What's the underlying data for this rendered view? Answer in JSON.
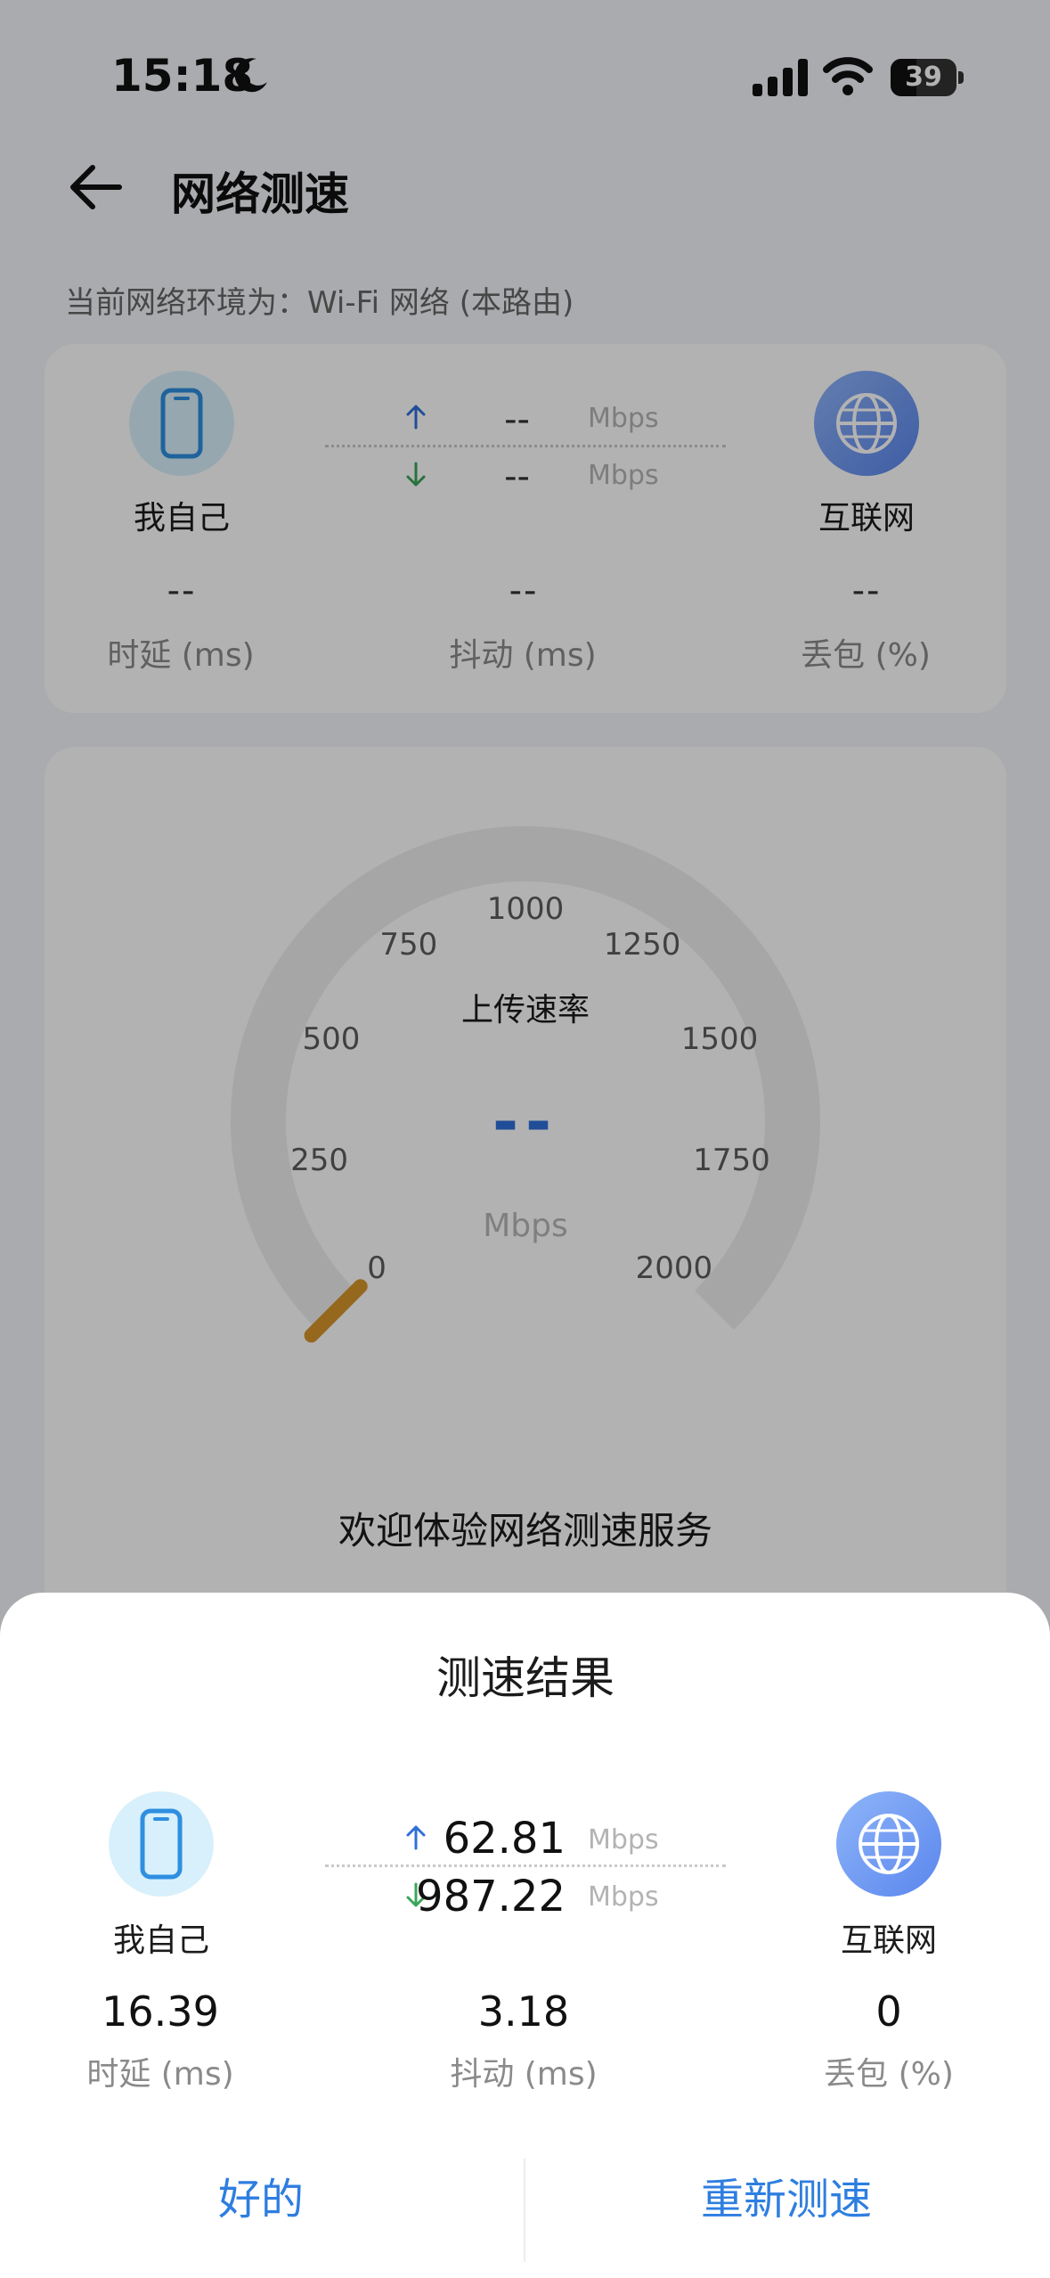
{
  "status_bar": {
    "time": "15:18",
    "battery": "39",
    "battery_level_percent": 39
  },
  "header": {
    "title": "网络测速"
  },
  "network_env": "当前网络环境为：Wi-Fi 网络 (本路由)",
  "summary_card": {
    "left_node": "我自己",
    "right_node": "互联网",
    "upload_value": "--",
    "download_value": "--",
    "upload_unit": "Mbps",
    "download_unit": "Mbps",
    "latency_value": "--",
    "latency_label": "时延 (ms)",
    "jitter_value": "--",
    "jitter_label": "抖动 (ms)",
    "loss_value": "--",
    "loss_label": "丢包 (%)"
  },
  "gauge": {
    "ticks": [
      "0",
      "250",
      "500",
      "750",
      "1000",
      "1250",
      "1500",
      "1750",
      "2000"
    ],
    "mode_label": "上传速率",
    "speed_value": "--",
    "unit": "Mbps",
    "needle_value": 0,
    "max_value": 2000
  },
  "welcome_text": "欢迎体验网络测速服务",
  "result_sheet": {
    "title": "测速结果",
    "left_node": "我自己",
    "right_node": "互联网",
    "upload_value": "62.81",
    "download_value": "987.22",
    "upload_unit": "Mbps",
    "download_unit": "Mbps",
    "latency_value": "16.39",
    "latency_label": "时延 (ms)",
    "jitter_value": "3.18",
    "jitter_label": "抖动 (ms)",
    "loss_value": "0",
    "loss_label": "丢包 (%)",
    "ok_button": "好的",
    "retest_button": "重新测速"
  },
  "colors": {
    "accent": "#2e7ee0",
    "upload_arrow": "#2f6fd9",
    "download_arrow": "#3aa55a",
    "needle": "#d6952c"
  },
  "icons": [
    "moon-icon",
    "signal-icon",
    "wifi-icon",
    "battery-icon",
    "back-arrow-icon",
    "phone-icon",
    "globe-icon",
    "upload-arrow-icon",
    "download-arrow-icon"
  ]
}
